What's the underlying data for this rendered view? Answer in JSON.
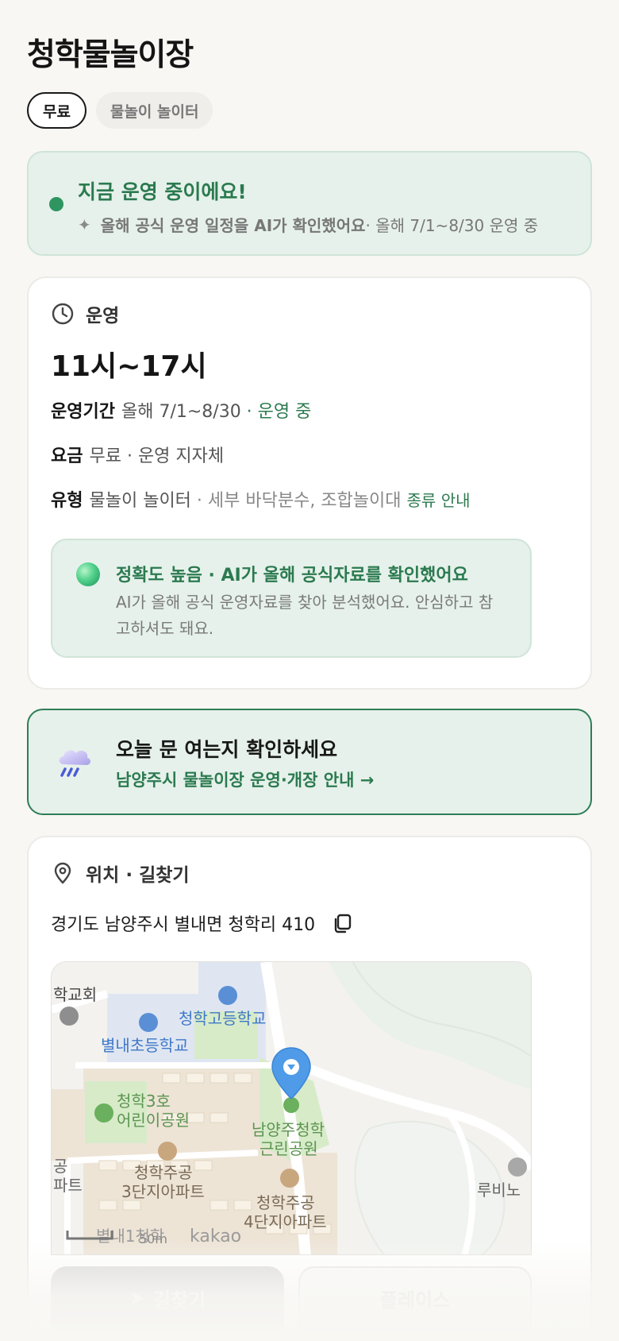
{
  "place": {
    "title": "청학물놀이장",
    "chips": [
      "무료",
      "물놀이 놀이터"
    ]
  },
  "status": {
    "title": "지금 운영 중이에요!",
    "ai_note": "올해 공식 운영 일정을 AI가 확인했어요",
    "period": " · 올해 7/1~8/30 운영 중"
  },
  "operation": {
    "heading": "운영",
    "hours": "11시~17시",
    "period_label": "운영기간",
    "period_value": "올해 7/1~8/30",
    "period_status": " · 운영 중",
    "fee_label": "요금",
    "fee_value": "무료 · 운영 지자체",
    "type_label": "유형",
    "type_value": "물놀이 놀이터",
    "type_detail": " · 세부 바닥분수, 조합놀이대",
    "type_link": "종류 안내",
    "accuracy_title": "정확도 높음 · AI가 올해 공식자료를 확인했어요",
    "accuracy_text": "AI가 올해 공식 운영자료를 찾아 분석했어요. 안심하고 참고하셔도 돼요."
  },
  "notice": {
    "title": "오늘 문 여는지 확인하세요",
    "link": "남양주시 물놀이장 운영·개장 안내 →"
  },
  "location": {
    "heading": "위치 · 길찾기",
    "address": "경기도 남양주시 별내면 청학리 410",
    "map_labels": {
      "l1": "학교회",
      "l2": "청학고등학교",
      "l3": "별내초등학교",
      "l4": "청학3호",
      "l5": "어린이공원",
      "l6": "남양주청학",
      "l7": "근린공원",
      "l8": "청학주공",
      "l9": "3단지아파트",
      "l10": "청학주공",
      "l11": "4단지아파트",
      "l12": "루비노",
      "l13": "공",
      "l14": "파트",
      "l15": "별내1청학",
      "l16": "50m",
      "l17": "kakao"
    },
    "directions_button": "길찾기",
    "place_button": "플레이스"
  },
  "colors": {
    "accent_green": "#2b7a4f",
    "soft_green_bg": "#e6f1eb",
    "marker_blue": "#4f9be8"
  }
}
